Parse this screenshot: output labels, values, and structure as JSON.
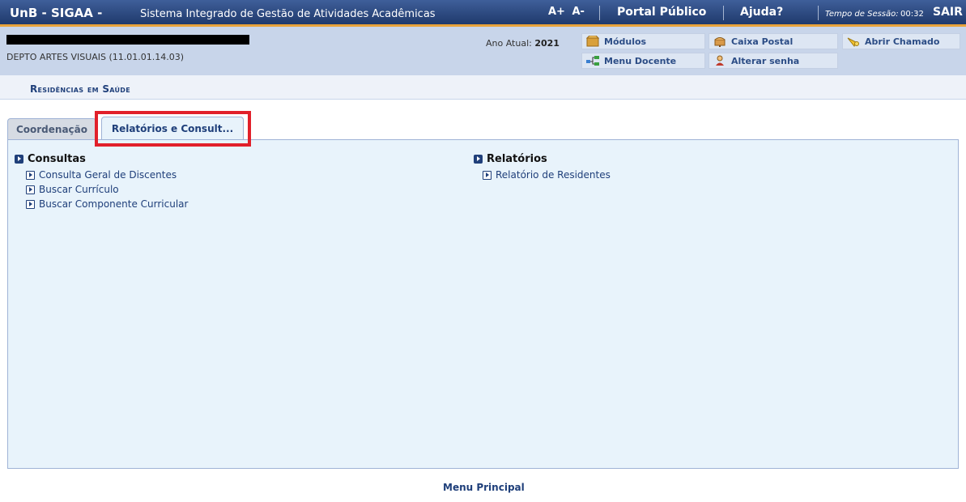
{
  "header": {
    "brand": "UnB - SIGAA -",
    "subtitle": "Sistema Integrado de Gestão de Atividades Acadêmicas",
    "font_increase": "A+",
    "font_decrease": "A-",
    "portal_publico": "Portal Público",
    "ajuda": "Ajuda?",
    "session_label": "Tempo de Sessão:",
    "session_time": "00:32",
    "sair": "SAIR"
  },
  "info": {
    "department": "DEPTO ARTES VISUAIS (11.01.01.14.03)",
    "ano_label": "Ano Atual:",
    "ano_value": "2021",
    "buttons": {
      "modulos": "Módulos",
      "caixa_postal": "Caixa Postal",
      "abrir_chamado": "Abrir Chamado",
      "menu_docente": "Menu Docente",
      "alterar_senha": "Alterar senha"
    }
  },
  "breadcrumb": "Residências em Saúde",
  "tabs": [
    {
      "label": "Coordenação",
      "active": false
    },
    {
      "label": "Relatórios e Consult...",
      "active": true
    }
  ],
  "sections": {
    "consultas": {
      "title": "Consultas",
      "items": [
        "Consulta Geral de Discentes",
        "Buscar Currículo",
        "Buscar Componente Curricular"
      ]
    },
    "relatorios": {
      "title": "Relatórios",
      "items": [
        "Relatório de Residentes"
      ]
    }
  },
  "footer": {
    "menu_principal": "Menu Principal"
  },
  "colors": {
    "header_bg": "#2d4a80",
    "accent_orange": "#e8a33a",
    "highlight_red": "#e1202a",
    "panel_bg": "#e8f3fb",
    "link": "#1f3f7a"
  }
}
